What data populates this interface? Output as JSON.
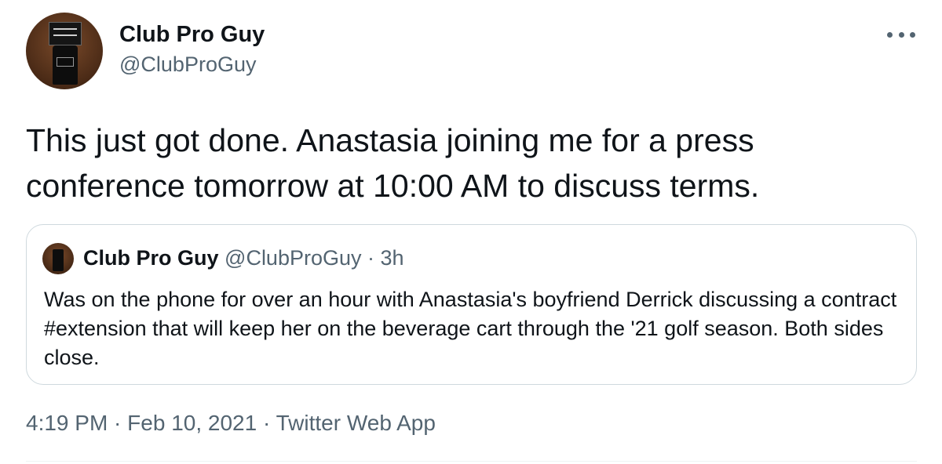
{
  "tweet": {
    "author_name": "Club Pro Guy",
    "author_handle": "@ClubProGuy",
    "text": "This just got done. Anastasia joining me for a press conference tomorrow at 10:00 AM to discuss terms.",
    "avatar_icon": "golf-bag-avatar-icon",
    "more_icon": "more-options-icon"
  },
  "quoted_tweet": {
    "author_name": "Club Pro Guy",
    "author_handle": "@ClubProGuy",
    "separator": " · ",
    "time_ago": "3h",
    "text": "Was on the phone for over an hour with Anastasia's boyfriend Derrick discussing a contract #extension that will keep her on the beverage cart through the '21 golf season. Both sides close."
  },
  "meta": {
    "time": "4:19 PM",
    "sep1": " · ",
    "date": "Feb 10, 2021",
    "sep2": " · ",
    "source": "Twitter Web App"
  },
  "colors": {
    "text_primary": "#0f1419",
    "text_secondary": "#536471",
    "border": "#cfd9de"
  }
}
